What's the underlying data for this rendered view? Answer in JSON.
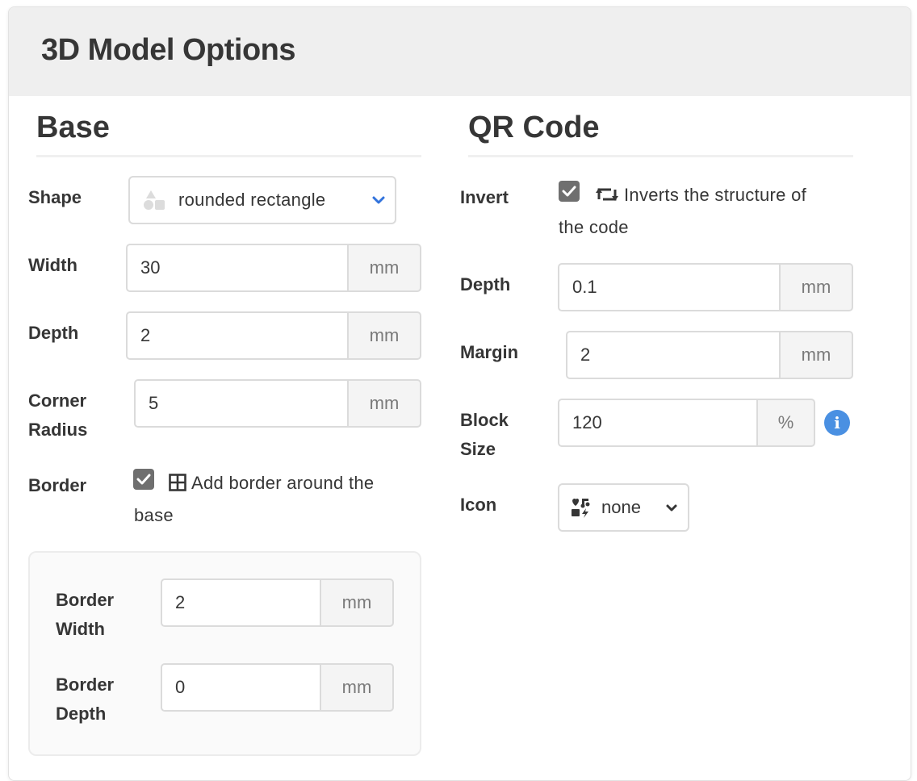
{
  "panel": {
    "title": "3D Model Options"
  },
  "base": {
    "title": "Base",
    "shape": {
      "label": "Shape",
      "value": "rounded rectangle"
    },
    "width": {
      "label": "Width",
      "value": "30",
      "unit": "mm"
    },
    "depth": {
      "label": "Depth",
      "value": "2",
      "unit": "mm"
    },
    "corner_radius": {
      "label_line1": "Corner",
      "label_line2": "Radius",
      "value": "5",
      "unit": "mm"
    },
    "border": {
      "label": "Border",
      "checked": true,
      "text_line1": "Add border around the",
      "text_line2": "base",
      "icon": "table-grid-icon"
    },
    "border_width": {
      "label_line1": "Border",
      "label_line2": "Width",
      "value": "2",
      "unit": "mm"
    },
    "border_depth": {
      "label_line1": "Border",
      "label_line2": "Depth",
      "value": "0",
      "unit": "mm"
    }
  },
  "qr": {
    "title": "QR Code",
    "invert": {
      "label": "Invert",
      "checked": true,
      "text_line1": "Inverts the structure of",
      "text_line2": "the code",
      "icon": "retweet-icon"
    },
    "depth": {
      "label": "Depth",
      "value": "0.1",
      "unit": "mm"
    },
    "margin": {
      "label": "Margin",
      "value": "2",
      "unit": "mm"
    },
    "block_size": {
      "label_line1": "Block",
      "label_line2": "Size",
      "value": "120",
      "unit": "%"
    },
    "icon": {
      "label": "Icon",
      "value": "none"
    }
  },
  "colors": {
    "header_bg": "#efefef",
    "checkbox": "#6f6f6f",
    "info": "#4a90e2",
    "chevron_blue": "#3273dc"
  }
}
